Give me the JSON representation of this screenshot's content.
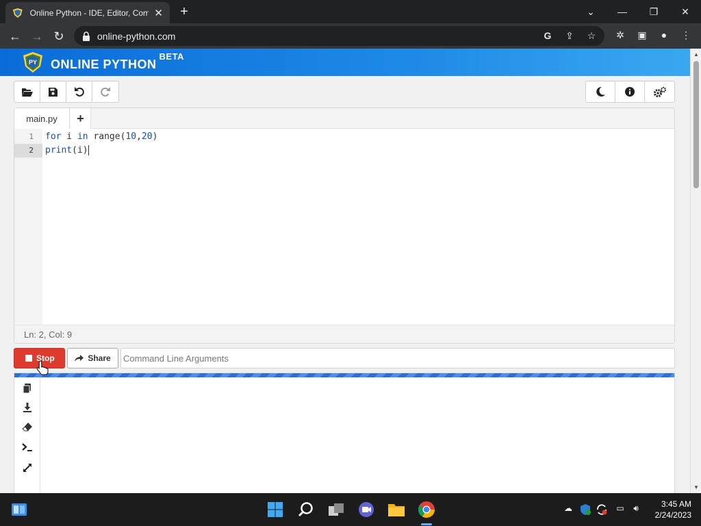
{
  "browser": {
    "tab_title": "Online Python - IDE, Editor, Compiler",
    "url": "online-python.com",
    "new_tab_label": "+",
    "tab_close_label": "✕"
  },
  "site": {
    "brand": "ONLINE PYTHON",
    "badge": "BETA",
    "logo_text": "PY"
  },
  "editor": {
    "file_tab": "main.py",
    "add_tab_label": "+",
    "lines": [
      {
        "number": "1",
        "keyword": "for",
        "text_after_kw": " i ",
        "kw2": "in",
        "rest": " range(",
        "num1": "10",
        "sep": ",",
        "num2": "20",
        "tail": ")"
      },
      {
        "number": "2",
        "fn": "print",
        "args": "(i)"
      }
    ],
    "status": "Ln: 2,  Col: 9"
  },
  "run_bar": {
    "stop_label": "Stop",
    "share_label": "Share",
    "args_placeholder": "Command Line Arguments"
  },
  "colors": {
    "header_blue": "#0a6cd8",
    "stop_red": "#de3b2f",
    "progress_blue": "#2a6fd1"
  },
  "taskbar": {
    "time": "3:45 AM",
    "date": "2/24/2023"
  }
}
